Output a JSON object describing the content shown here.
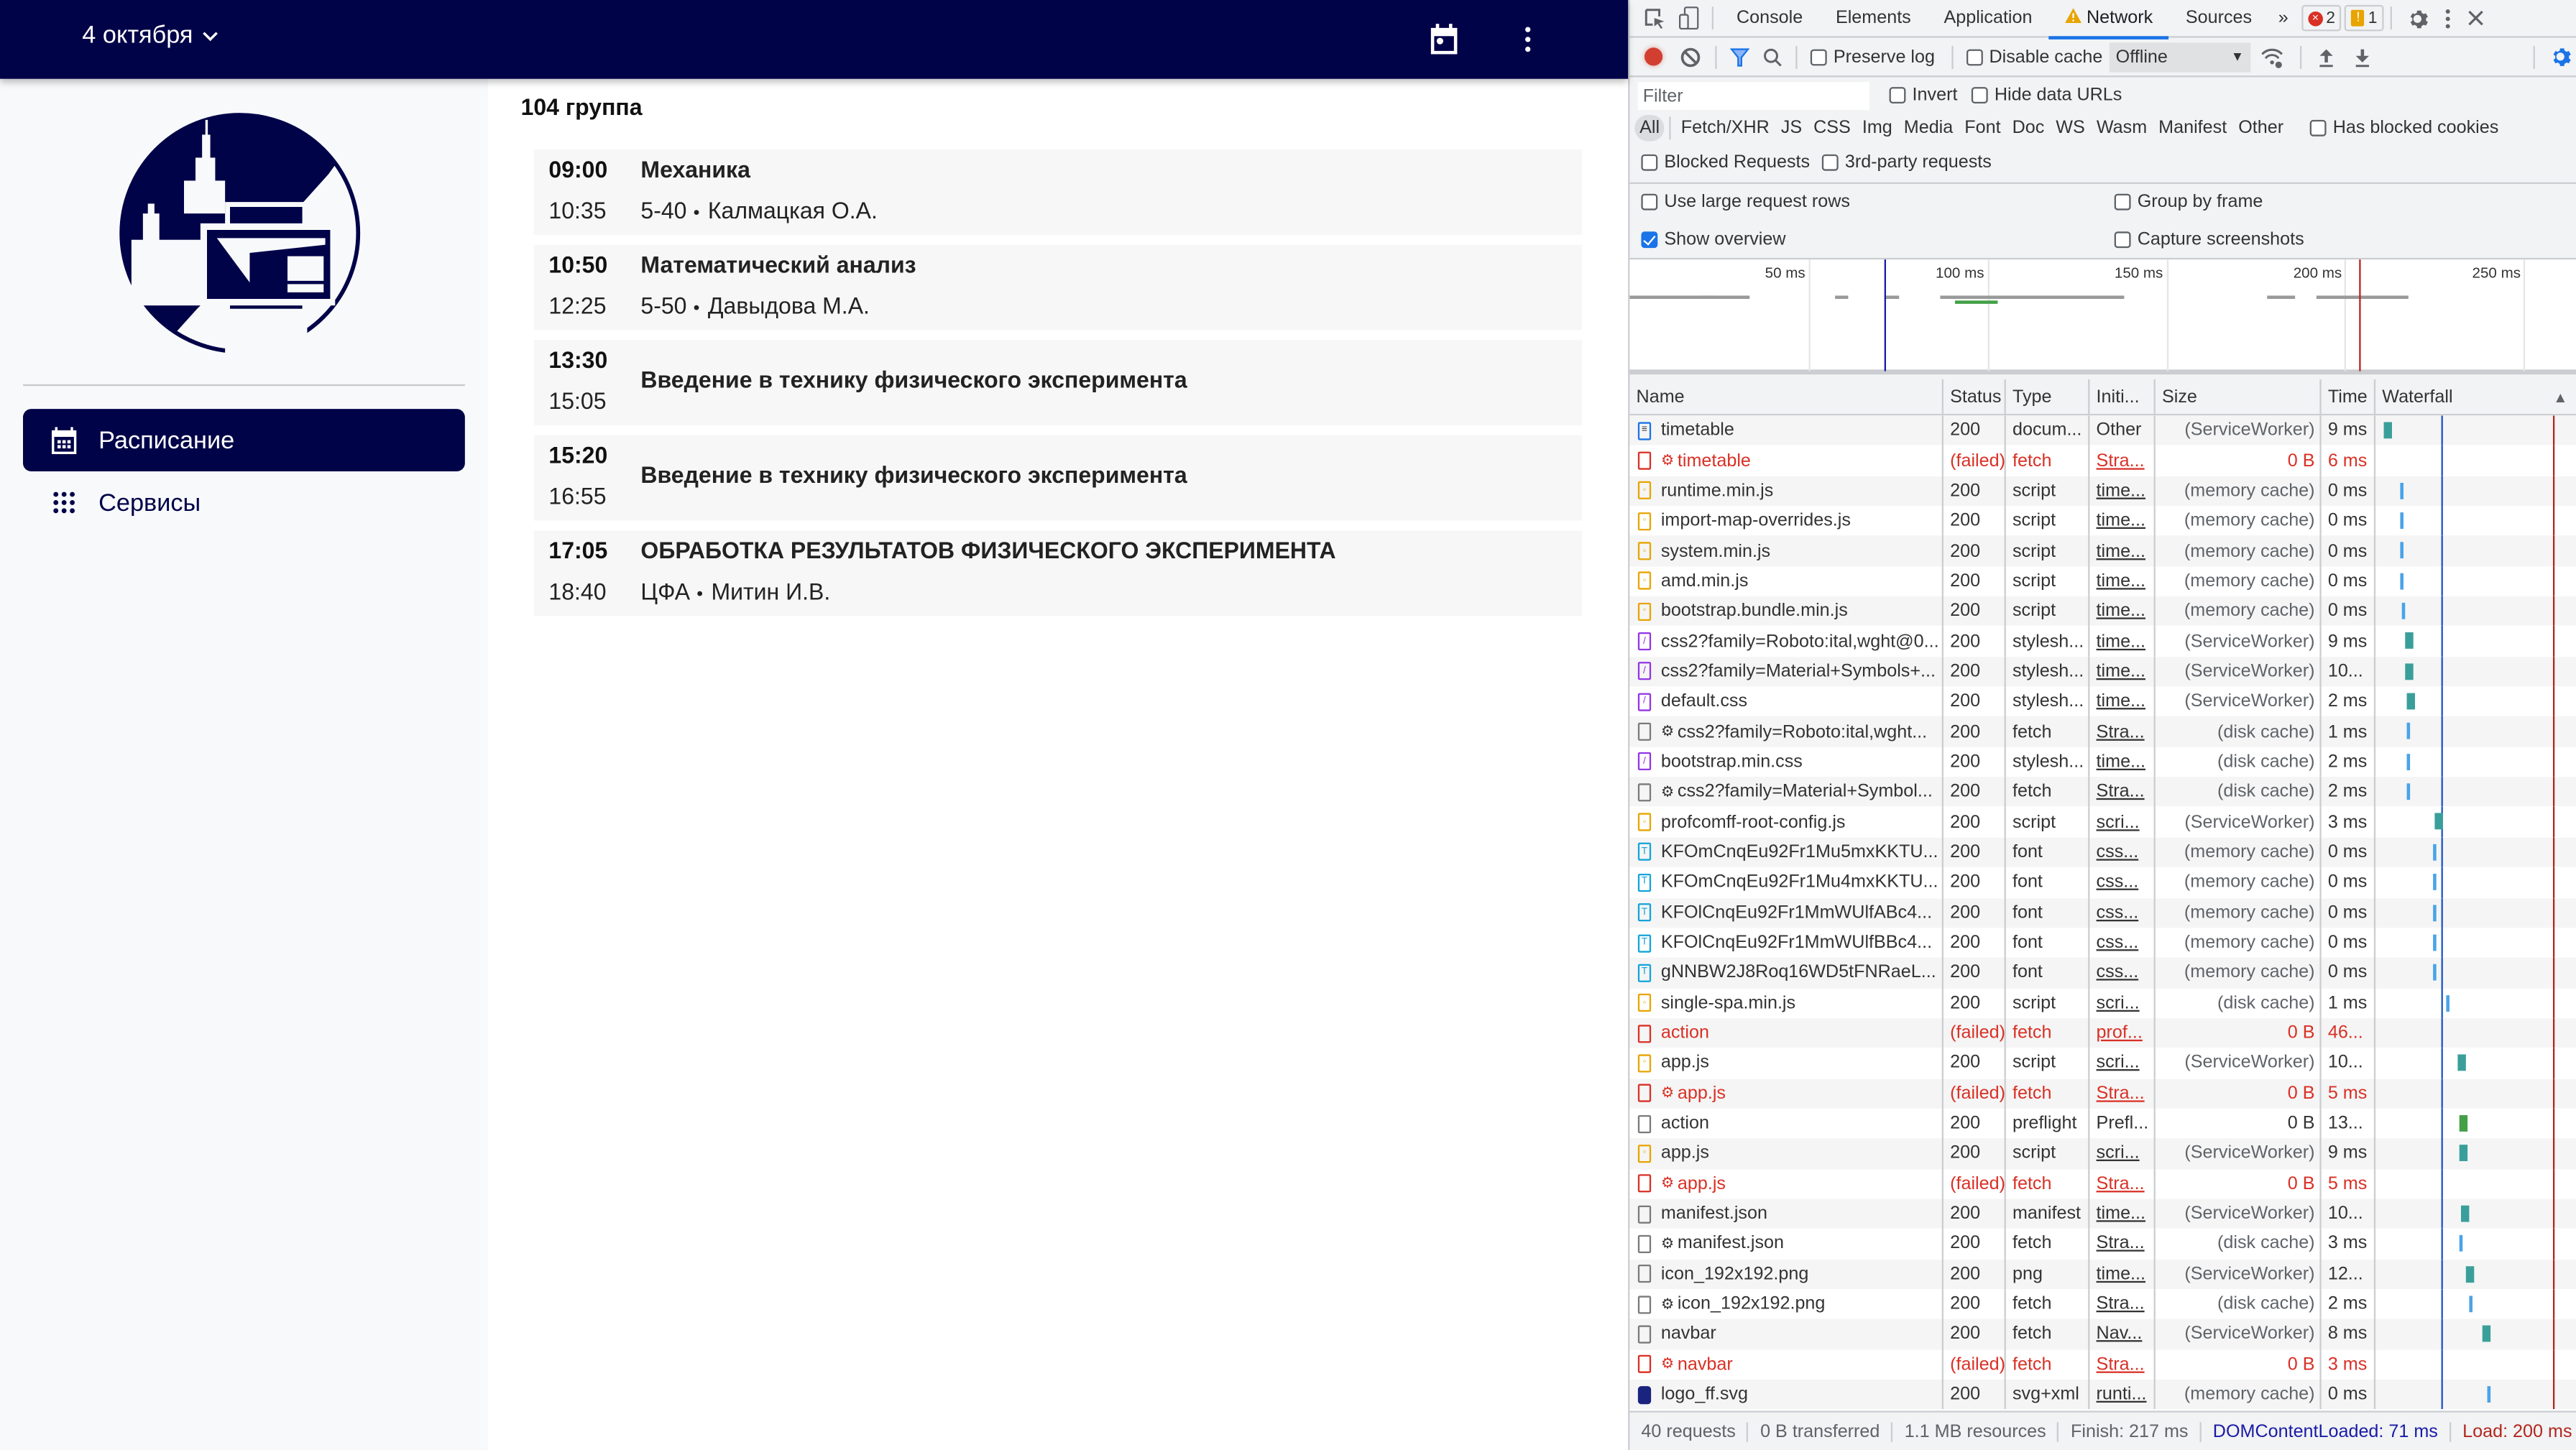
{
  "app": {
    "date_label": "4 октября",
    "group_title": "104 группа",
    "sidebar": {
      "items": [
        {
          "label": "Расписание",
          "icon": "calendar-icon",
          "active": true
        },
        {
          "label": "Сервисы",
          "icon": "apps-grid-icon",
          "active": false
        }
      ]
    },
    "lessons": [
      {
        "start": "09:00",
        "end": "10:35",
        "title": "Механика",
        "room": "5-40",
        "teacher": "Калмацкая О.А."
      },
      {
        "start": "10:50",
        "end": "12:25",
        "title": "Математический анализ",
        "room": "5-50",
        "teacher": "Давыдова М.А."
      },
      {
        "start": "13:30",
        "end": "15:05",
        "title": "Введение в технику физического эксперимента",
        "room": "",
        "teacher": ""
      },
      {
        "start": "15:20",
        "end": "16:55",
        "title": "Введение в технику физического эксперимента",
        "room": "",
        "teacher": ""
      },
      {
        "start": "17:05",
        "end": "18:40",
        "title": "ОБРАБОТКА РЕЗУЛЬТАТОВ ФИЗИЧЕСКОГО ЭКСПЕРИМЕНТА",
        "room": "ЦФА",
        "teacher": "Митин И.В."
      }
    ],
    "bullet": "•",
    "colors": {
      "brand": "#000348",
      "card_bg": "#f7f7f7",
      "sidebar_bg": "#f8f9fb"
    }
  },
  "devtools": {
    "tabs": [
      "Console",
      "Elements",
      "Application",
      "Network",
      "Sources"
    ],
    "active_tab": "Network",
    "more_tabs": "»",
    "errors_count": "2",
    "warnings_count": "1",
    "toolbar": {
      "preserve_log": "Preserve log",
      "disable_cache": "Disable cache",
      "throttle": "Offline"
    },
    "filter": {
      "placeholder": "Filter",
      "invert": "Invert",
      "hide_data_urls": "Hide data URLs",
      "types": [
        "All",
        "Fetch/XHR",
        "JS",
        "CSS",
        "Img",
        "Media",
        "Font",
        "Doc",
        "WS",
        "Wasm",
        "Manifest",
        "Other"
      ],
      "active_type": "All",
      "has_blocked_cookies": "Has blocked cookies",
      "blocked_requests": "Blocked Requests",
      "third_party": "3rd-party requests"
    },
    "settings": {
      "large_rows": "Use large request rows",
      "group_by_frame": "Group by frame",
      "show_overview": "Show overview",
      "show_overview_checked": true,
      "capture_screenshots": "Capture screenshots"
    },
    "overview": {
      "ticks": [
        "50 ms",
        "100 ms",
        "150 ms",
        "200 ms",
        "250 ms"
      ]
    },
    "columns": [
      "Name",
      "Status",
      "Type",
      "Initi...",
      "Size",
      "Time",
      "Waterfall"
    ],
    "requests": [
      {
        "name": "timetable",
        "status": "200",
        "type": "docum...",
        "initiator": "Other",
        "size": "(ServiceWorker)",
        "time": "9 ms",
        "icon": "doc",
        "failed": false,
        "gear": false,
        "link": false,
        "wf": 0.0
      },
      {
        "name": "timetable",
        "status": "(failed)",
        "type": "fetch",
        "initiator": "Stra...",
        "size": "0 B",
        "time": "6 ms",
        "icon": "fail",
        "failed": true,
        "gear": true,
        "link": true,
        "wf": null
      },
      {
        "name": "runtime.min.js",
        "status": "200",
        "type": "script",
        "initiator": "time...",
        "size": "(memory cache)",
        "time": "0 ms",
        "icon": "script",
        "failed": false,
        "gear": false,
        "link": true,
        "wf": 0.1
      },
      {
        "name": "import-map-overrides.js",
        "status": "200",
        "type": "script",
        "initiator": "time...",
        "size": "(memory cache)",
        "time": "0 ms",
        "icon": "script",
        "failed": false,
        "gear": false,
        "link": true,
        "wf": 0.1
      },
      {
        "name": "system.min.js",
        "status": "200",
        "type": "script",
        "initiator": "time...",
        "size": "(memory cache)",
        "time": "0 ms",
        "icon": "script",
        "failed": false,
        "gear": false,
        "link": true,
        "wf": 0.1
      },
      {
        "name": "amd.min.js",
        "status": "200",
        "type": "script",
        "initiator": "time...",
        "size": "(memory cache)",
        "time": "0 ms",
        "icon": "script",
        "failed": false,
        "gear": false,
        "link": true,
        "wf": 0.1
      },
      {
        "name": "bootstrap.bundle.min.js",
        "status": "200",
        "type": "script",
        "initiator": "time...",
        "size": "(memory cache)",
        "time": "0 ms",
        "icon": "script",
        "failed": false,
        "gear": false,
        "link": true,
        "wf": 0.11
      },
      {
        "name": "css2?family=Roboto:ital,wght@0...",
        "status": "200",
        "type": "stylesh...",
        "initiator": "time...",
        "size": "(ServiceWorker)",
        "time": "9 ms",
        "icon": "css",
        "failed": false,
        "gear": false,
        "link": true,
        "wf": 0.13
      },
      {
        "name": "css2?family=Material+Symbols+...",
        "status": "200",
        "type": "stylesh...",
        "initiator": "time...",
        "size": "(ServiceWorker)",
        "time": "10...",
        "icon": "css",
        "failed": false,
        "gear": false,
        "link": true,
        "wf": 0.13
      },
      {
        "name": "default.css",
        "status": "200",
        "type": "stylesh...",
        "initiator": "time...",
        "size": "(ServiceWorker)",
        "time": "2 ms",
        "icon": "css",
        "failed": false,
        "gear": false,
        "link": true,
        "wf": 0.14
      },
      {
        "name": "css2?family=Roboto:ital,wght...",
        "status": "200",
        "type": "fetch",
        "initiator": "Stra...",
        "size": "(disk cache)",
        "time": "1 ms",
        "icon": "other",
        "failed": false,
        "gear": true,
        "link": true,
        "wf": 0.14
      },
      {
        "name": "bootstrap.min.css",
        "status": "200",
        "type": "stylesh...",
        "initiator": "time...",
        "size": "(disk cache)",
        "time": "2 ms",
        "icon": "css",
        "failed": false,
        "gear": false,
        "link": true,
        "wf": 0.14
      },
      {
        "name": "css2?family=Material+Symbol...",
        "status": "200",
        "type": "fetch",
        "initiator": "Stra...",
        "size": "(disk cache)",
        "time": "2 ms",
        "icon": "other",
        "failed": false,
        "gear": true,
        "link": true,
        "wf": 0.14
      },
      {
        "name": "profcomff-root-config.js",
        "status": "200",
        "type": "script",
        "initiator": "scri...",
        "size": "(ServiceWorker)",
        "time": "3 ms",
        "icon": "script",
        "failed": false,
        "gear": false,
        "link": true,
        "wf": 0.31
      },
      {
        "name": "KFOmCnqEu92Fr1Mu5mxKKTU...",
        "status": "200",
        "type": "font",
        "initiator": "css...",
        "size": "(memory cache)",
        "time": "0 ms",
        "icon": "font",
        "failed": false,
        "gear": false,
        "link": true,
        "wf": 0.3
      },
      {
        "name": "KFOmCnqEu92Fr1Mu4mxKKTU...",
        "status": "200",
        "type": "font",
        "initiator": "css...",
        "size": "(memory cache)",
        "time": "0 ms",
        "icon": "font",
        "failed": false,
        "gear": false,
        "link": true,
        "wf": 0.3
      },
      {
        "name": "KFOlCnqEu92Fr1MmWUlfABc4...",
        "status": "200",
        "type": "font",
        "initiator": "css...",
        "size": "(memory cache)",
        "time": "0 ms",
        "icon": "font",
        "failed": false,
        "gear": false,
        "link": true,
        "wf": 0.3
      },
      {
        "name": "KFOlCnqEu92Fr1MmWUlfBBc4...",
        "status": "200",
        "type": "font",
        "initiator": "css...",
        "size": "(memory cache)",
        "time": "0 ms",
        "icon": "font",
        "failed": false,
        "gear": false,
        "link": true,
        "wf": 0.3
      },
      {
        "name": "gNNBW2J8Roq16WD5tFNRaeL...",
        "status": "200",
        "type": "font",
        "initiator": "css...",
        "size": "(memory cache)",
        "time": "0 ms",
        "icon": "font",
        "failed": false,
        "gear": false,
        "link": true,
        "wf": 0.3
      },
      {
        "name": "single-spa.min.js",
        "status": "200",
        "type": "script",
        "initiator": "scri...",
        "size": "(disk cache)",
        "time": "1 ms",
        "icon": "script",
        "failed": false,
        "gear": false,
        "link": true,
        "wf": 0.38
      },
      {
        "name": "action",
        "status": "(failed)",
        "type": "fetch",
        "initiator": "prof...",
        "size": "0 B",
        "time": "46...",
        "icon": "fail",
        "failed": true,
        "gear": false,
        "link": true,
        "wf": null
      },
      {
        "name": "app.js",
        "status": "200",
        "type": "script",
        "initiator": "scri...",
        "size": "(ServiceWorker)",
        "time": "10...",
        "icon": "script",
        "failed": false,
        "gear": false,
        "link": true,
        "wf": 0.45
      },
      {
        "name": "app.js",
        "status": "(failed)",
        "type": "fetch",
        "initiator": "Stra...",
        "size": "0 B",
        "time": "5 ms",
        "icon": "fail",
        "failed": true,
        "gear": true,
        "link": true,
        "wf": null
      },
      {
        "name": "action",
        "status": "200",
        "type": "preflight",
        "initiator": "Prefl...",
        "size": "0 B",
        "time": "13...",
        "icon": "other",
        "failed": false,
        "gear": false,
        "link": false,
        "wf": 0.46
      },
      {
        "name": "app.js",
        "status": "200",
        "type": "script",
        "initiator": "scri...",
        "size": "(ServiceWorker)",
        "time": "9 ms",
        "icon": "script",
        "failed": false,
        "gear": false,
        "link": true,
        "wf": 0.46
      },
      {
        "name": "app.js",
        "status": "(failed)",
        "type": "fetch",
        "initiator": "Stra...",
        "size": "0 B",
        "time": "5 ms",
        "icon": "fail",
        "failed": true,
        "gear": true,
        "link": true,
        "wf": null
      },
      {
        "name": "manifest.json",
        "status": "200",
        "type": "manifest",
        "initiator": "time...",
        "size": "(ServiceWorker)",
        "time": "10...",
        "icon": "other",
        "failed": false,
        "gear": false,
        "link": true,
        "wf": 0.47
      },
      {
        "name": "manifest.json",
        "status": "200",
        "type": "fetch",
        "initiator": "Stra...",
        "size": "(disk cache)",
        "time": "3 ms",
        "icon": "other",
        "failed": false,
        "gear": true,
        "link": true,
        "wf": 0.46
      },
      {
        "name": "icon_192x192.png",
        "status": "200",
        "type": "png",
        "initiator": "time...",
        "size": "(ServiceWorker)",
        "time": "12...",
        "icon": "other",
        "failed": false,
        "gear": false,
        "link": true,
        "wf": 0.5
      },
      {
        "name": "icon_192x192.png",
        "status": "200",
        "type": "fetch",
        "initiator": "Stra...",
        "size": "(disk cache)",
        "time": "2 ms",
        "icon": "other",
        "failed": false,
        "gear": true,
        "link": true,
        "wf": 0.52
      },
      {
        "name": "navbar",
        "status": "200",
        "type": "fetch",
        "initiator": "Nav...",
        "size": "(ServiceWorker)",
        "time": "8 ms",
        "icon": "other",
        "failed": false,
        "gear": false,
        "link": true,
        "wf": 0.6
      },
      {
        "name": "navbar",
        "status": "(failed)",
        "type": "fetch",
        "initiator": "Stra...",
        "size": "0 B",
        "time": "3 ms",
        "icon": "fail",
        "failed": true,
        "gear": true,
        "link": true,
        "wf": null
      },
      {
        "name": "logo_ff.svg",
        "status": "200",
        "type": "svg+xml",
        "initiator": "runti...",
        "size": "(memory cache)",
        "time": "0 ms",
        "icon": "img",
        "failed": false,
        "gear": false,
        "link": true,
        "wf": 0.63
      }
    ],
    "summary": {
      "requests": "40 requests",
      "transferred": "0 B transferred",
      "resources": "1.1 MB resources",
      "finish": "Finish: 217 ms",
      "dom_content_loaded": "DOMContentLoaded: 71 ms",
      "load": "Load: 200 ms"
    },
    "colors": {
      "accent": "#1a73e8",
      "error": "#d93025",
      "dcl": "#1a1aa6",
      "load": "#b3261e"
    }
  }
}
